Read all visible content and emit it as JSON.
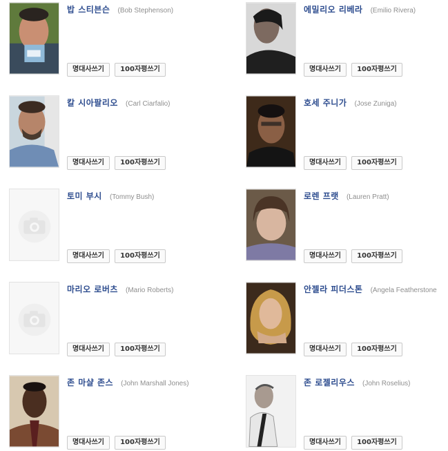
{
  "buttons": {
    "card_label": "명대사쓰기",
    "review_label": "100자평쓰기"
  },
  "people": [
    {
      "korean": "밥 스티븐슨",
      "english": "(Bob Stephenson)",
      "photo": "photo"
    },
    {
      "korean": "에밀리오 리베라",
      "english": "(Emilio Rivera)",
      "photo": "photo"
    },
    {
      "korean": "칼 시아팔리오",
      "english": "(Carl Ciarfalio)",
      "photo": "photo"
    },
    {
      "korean": "호세 주니가",
      "english": "(Jose Zuniga)",
      "photo": "photo"
    },
    {
      "korean": "토미 부시",
      "english": "(Tommy Bush)",
      "photo": "placeholder-camera-icon"
    },
    {
      "korean": "로렌 프랫",
      "english": "(Lauren Pratt)",
      "photo": "photo"
    },
    {
      "korean": "마리오 로버츠",
      "english": "(Mario Roberts)",
      "photo": "placeholder-camera-icon"
    },
    {
      "korean": "안젤라 피더스톤",
      "english": "(Angela Featherstone",
      "photo": "photo"
    },
    {
      "korean": "존 마샬 존스",
      "english": "(John Marshall Jones)",
      "photo": "photo"
    },
    {
      "korean": "존 로젤리우스",
      "english": "(John Roselius)",
      "photo": "photo"
    }
  ]
}
